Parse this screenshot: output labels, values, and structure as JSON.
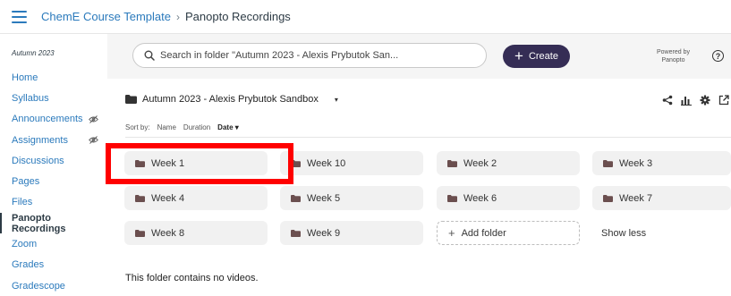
{
  "breadcrumb": {
    "course": "ChemE Course Template",
    "separator": "›",
    "current": "Panopto Recordings"
  },
  "sidebar": {
    "term": "Autumn 2023",
    "items": [
      {
        "label": "Home",
        "hidden": false,
        "active": false
      },
      {
        "label": "Syllabus",
        "hidden": false,
        "active": false
      },
      {
        "label": "Announcements",
        "hidden": true,
        "active": false
      },
      {
        "label": "Assignments",
        "hidden": true,
        "active": false
      },
      {
        "label": "Discussions",
        "hidden": false,
        "active": false
      },
      {
        "label": "Pages",
        "hidden": false,
        "active": false
      },
      {
        "label": "Files",
        "hidden": false,
        "active": false
      },
      {
        "label": "Panopto Recordings",
        "hidden": false,
        "active": true
      },
      {
        "label": "Zoom",
        "hidden": false,
        "active": false
      },
      {
        "label": "Grades",
        "hidden": false,
        "active": false
      },
      {
        "label": "Gradescope",
        "hidden": false,
        "active": false
      }
    ]
  },
  "toolbar": {
    "search_placeholder": "Search in folder \"Autumn 2023 - Alexis Prybutok San...",
    "create_label": "Create",
    "powered_by": "Powered by",
    "powered_brand": "Panopto",
    "help_glyph": "?"
  },
  "folder": {
    "title": "Autumn 2023 - Alexis Prybutok Sandbox",
    "caret": "▾",
    "actions": [
      "share-icon",
      "stats-icon",
      "settings-icon",
      "open-external-icon"
    ]
  },
  "sort": {
    "label": "Sort by:",
    "options": [
      {
        "label": "Name",
        "active": false
      },
      {
        "label": "Duration",
        "active": false
      },
      {
        "label": "Date ▾",
        "active": true
      }
    ]
  },
  "subfolders": [
    {
      "label": "Week 1"
    },
    {
      "label": "Week 10"
    },
    {
      "label": "Week 2"
    },
    {
      "label": "Week 3"
    },
    {
      "label": "Week 4"
    },
    {
      "label": "Week 5"
    },
    {
      "label": "Week 6"
    },
    {
      "label": "Week 7"
    },
    {
      "label": "Week 8"
    },
    {
      "label": "Week 9"
    }
  ],
  "add_folder_label": "Add folder",
  "show_less_label": "Show less",
  "empty_message": "This folder contains no videos.",
  "colors": {
    "link": "#2b7abc",
    "create_bg": "#352d55",
    "highlight": "#ff0000",
    "folder_icon": "#6b4f4f"
  }
}
